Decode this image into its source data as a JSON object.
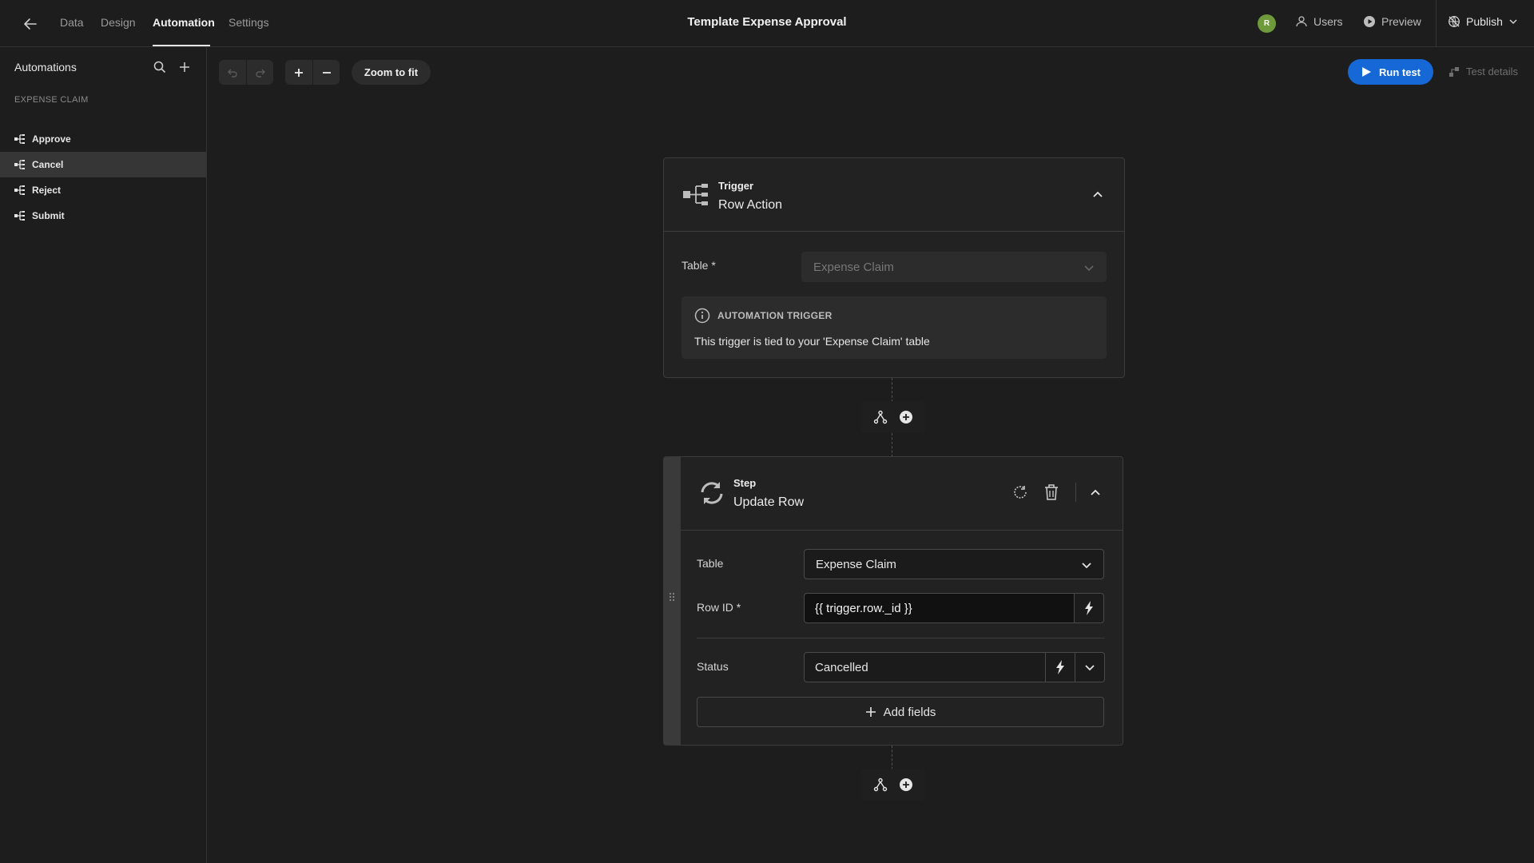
{
  "nav": {
    "tabs": [
      "Data",
      "Design",
      "Automation",
      "Settings"
    ],
    "active_tab": "Automation"
  },
  "app": {
    "title": "Template Expense Approval"
  },
  "user": {
    "initial": "R",
    "avatar_color": "#6e9a3b"
  },
  "top_actions": {
    "users": "Users",
    "preview": "Preview",
    "publish": "Publish"
  },
  "sidebar": {
    "title": "Automations",
    "section": "EXPENSE CLAIM",
    "items": [
      "Approve",
      "Cancel",
      "Reject",
      "Submit"
    ],
    "active_item": "Cancel"
  },
  "toolbar": {
    "zoom_to_fit": "Zoom to fit",
    "run_test": "Run test",
    "test_details": "Test details"
  },
  "trigger": {
    "kicker": "Trigger",
    "title": "Row Action",
    "table_label": "Table *",
    "table_value": "Expense Claim",
    "info_title": "AUTOMATION TRIGGER",
    "info_text": "This trigger is tied to your 'Expense Claim' table"
  },
  "step": {
    "kicker": "Step",
    "title": "Update Row",
    "table_label": "Table",
    "table_value": "Expense Claim",
    "row_id_label": "Row ID *",
    "row_id_value": "{{ trigger.row._id }}",
    "status_label": "Status",
    "status_value": "Cancelled",
    "add_fields": "Add fields"
  },
  "colors": {
    "accent": "#1568d6",
    "background": "#1d1d1d",
    "card": "#222222"
  }
}
